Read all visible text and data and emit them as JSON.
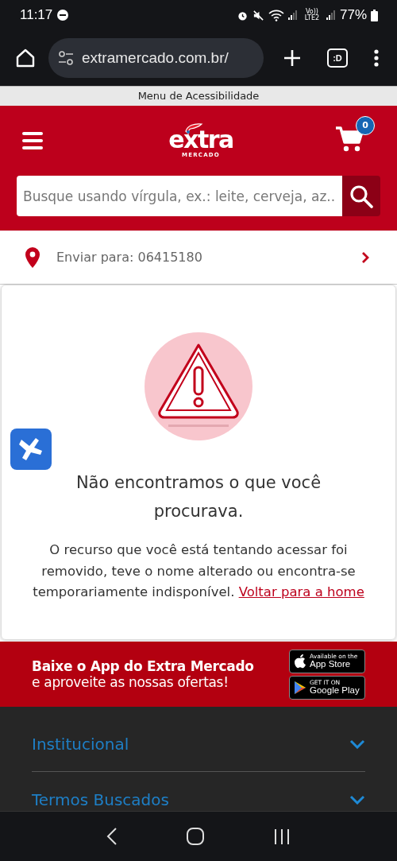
{
  "status_bar": {
    "time": "11:17",
    "network_label": "Vo)) LTE2",
    "battery": "77%"
  },
  "browser": {
    "url": "extramercado.com.br/",
    "tabs_button": ":D"
  },
  "accessibility_menu": "Menu de Acessibilidade",
  "header": {
    "logo": "extra",
    "logo_sub": "MERCADO",
    "cart_count": "0",
    "search": {
      "placeholder": "Busque usando vírgula, ex.: leite, cerveja, az..."
    }
  },
  "delivery": {
    "label": "Enviar para: 06415180"
  },
  "error": {
    "title": "Não encontramos o que você procurava.",
    "message": "O recurso que você está tentando acessar foi removido, teve o nome alterado ou encontra-se temporariamente indisponível.",
    "link": "Voltar para a home"
  },
  "app_banner": {
    "line1": "Baixe o App do Extra Mercado",
    "line2": "e aproveite as nossas ofertas!",
    "stores": [
      {
        "kind": "apple",
        "small": "Available on the",
        "big": "App Store"
      },
      {
        "kind": "google",
        "small": "GET IT ON",
        "big": "Google Play"
      }
    ]
  },
  "footer": {
    "sections": [
      {
        "label": "Institucional",
        "expanded": false
      },
      {
        "label": "Termos Buscados",
        "expanded": false
      }
    ]
  }
}
